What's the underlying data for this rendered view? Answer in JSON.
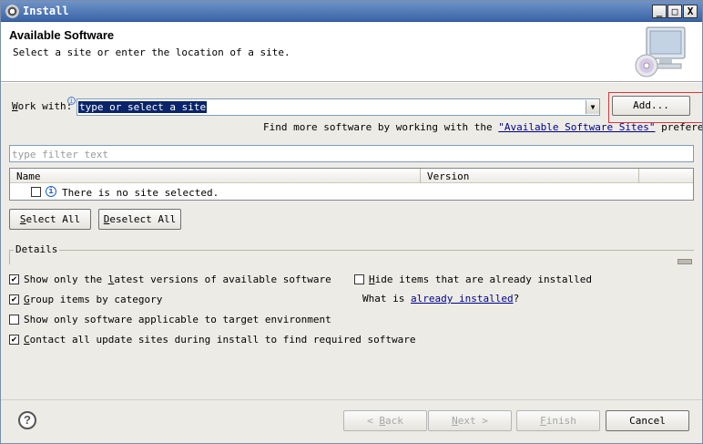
{
  "window": {
    "title": "Install",
    "minimize": "_",
    "maximize": "□",
    "close": "X"
  },
  "banner": {
    "title": "Available Software",
    "description": "Select a site or enter the location of a site."
  },
  "work_with": {
    "label": "Work with:",
    "info_icon": "info-icon",
    "value": "type or select a site",
    "add_button": "Add...",
    "find_more_prefix": "Find more software by working with the",
    "find_more_link": "\"Available Software Sites\"",
    "find_more_suffix": "preferences."
  },
  "filter": {
    "placeholder": "type filter text"
  },
  "table": {
    "columns": [
      "Name",
      "Version"
    ],
    "rows": [
      {
        "name": "There is no site selected.",
        "checked": false
      }
    ]
  },
  "buttons": {
    "select_all": "Select All",
    "deselect_all": "Deselect All"
  },
  "details": {
    "label": "Details"
  },
  "options": [
    {
      "label": "Show only the latest versions of available software",
      "checked": true
    },
    {
      "label": "Group items by category",
      "checked": true
    },
    {
      "label": "Show only software applicable to target environment",
      "checked": false
    },
    {
      "label": "Contact all update sites during install to find required software",
      "checked": true
    }
  ],
  "hide_installed": {
    "label": "Hide items that are already installed",
    "checked": false
  },
  "what_is": {
    "prefix": "What is",
    "link": "already installed",
    "suffix": "?"
  },
  "footer": {
    "help_icon": "help-icon",
    "back": "< Back",
    "next": "Next >",
    "finish": "Finish",
    "cancel": "Cancel"
  },
  "colors": {
    "titlebar": "#3a65a8",
    "dialog_bg": "#ecebe5",
    "selection": "#0a246a",
    "link": "#00008b",
    "highlight": "#d9363e"
  }
}
